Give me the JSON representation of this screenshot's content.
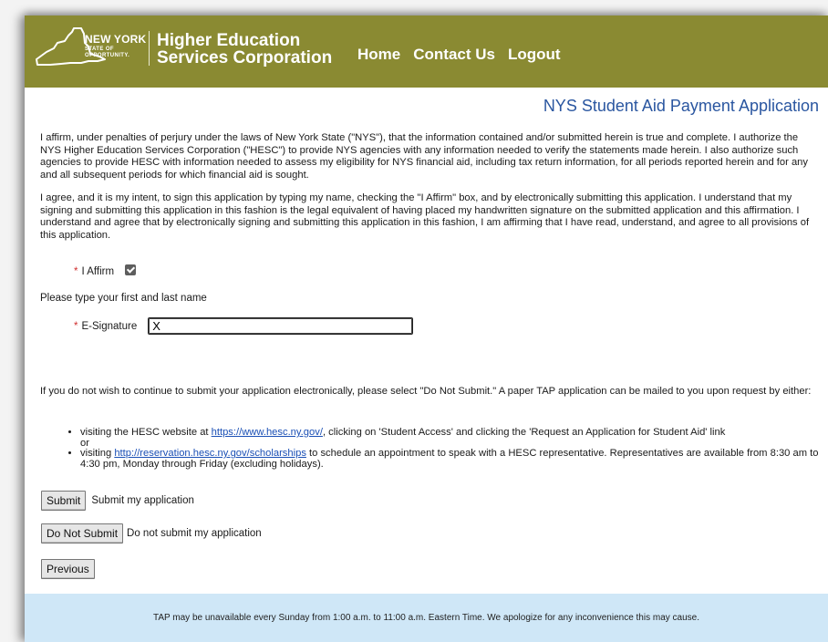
{
  "header": {
    "logo_line1": "NEW YORK",
    "logo_line2": "STATE OF",
    "logo_line3": "OPPORTUNITY.",
    "org_line1": "Higher Education",
    "org_line2": "Services Corporation",
    "nav": [
      {
        "label": "Home"
      },
      {
        "label": "Contact Us"
      },
      {
        "label": "Logout"
      }
    ],
    "background_color": "#8a8a32"
  },
  "app_title": "NYS Student Aid Payment Application",
  "affirmation": {
    "paragraph1": "I affirm, under penalties of perjury under the laws of New York State (\"NYS\"), that the information contained and/or submitted herein is true and complete. I authorize the NYS Higher Education Services Corporation (\"HESC\") to provide NYS agencies with any information needed to verify the statements made herein. I also authorize such agencies to provide HESC with information needed to assess my eligibility for NYS financial aid, including tax return information, for all periods reported herein and for any and all subsequent periods for which financial aid is sought.",
    "paragraph2": "I agree, and it is my intent, to sign this application by typing my name, checking the \"I Affirm\" box, and by electronically submitting this application. I understand that my signing and submitting this application in this fashion is the legal equivalent of having placed my handwritten signature on the submitted application and this affirmation. I understand and agree that by electronically signing and submitting this application in this fashion, I am affirming that I have read, understand, and agree to all provisions of this application."
  },
  "form": {
    "required_marker": "*",
    "affirm_label": "I Affirm",
    "affirm_checked": true,
    "type_name_instruction": "Please type your first and last name",
    "esignature_label": "E-Signature",
    "esignature_value": "X"
  },
  "do_not_submit_info": {
    "intro": "If you do not wish to continue to submit your application electronically, please select \"Do Not Submit.\" A paper TAP application can be mailed to you upon request by either:",
    "bullet1_prefix": "visiting the HESC website at ",
    "bullet1_link": "https://www.hesc.ny.gov/",
    "bullet1_suffix": ", clicking on 'Student Access' and clicking the 'Request an Application for Student Aid' link",
    "bullet1_or": "or",
    "bullet2_prefix": "visiting ",
    "bullet2_link": "http://reservation.hesc.ny.gov/scholarships",
    "bullet2_suffix": " to schedule an appointment to speak with a HESC representative. Representatives are available from 8:30 am to 4:30 pm, Monday through Friday (excluding holidays)."
  },
  "actions": {
    "submit_label": "Submit",
    "submit_desc": "Submit my application",
    "do_not_submit_label": "Do Not Submit",
    "do_not_submit_desc": "Do not submit my application",
    "previous_label": "Previous"
  },
  "footer_notice": "TAP may be unavailable every Sunday from 1:00 a.m. to 11:00 a.m. Eastern Time. We apologize for any inconvenience this may cause.",
  "colors": {
    "title_blue": "#2a56a0",
    "link_blue": "#1a4fb5",
    "required_red": "#d03030",
    "footer_bg": "#cfe7f7"
  }
}
